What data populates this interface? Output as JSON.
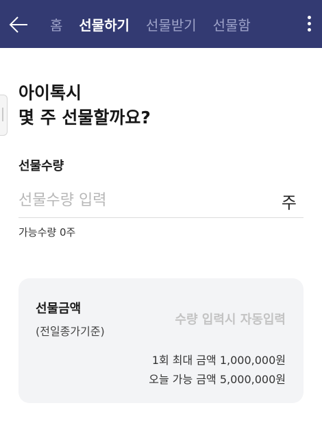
{
  "nav": {
    "tabs": [
      {
        "label": "홈",
        "active": false
      },
      {
        "label": "선물하기",
        "active": true
      },
      {
        "label": "선물받기",
        "active": false
      },
      {
        "label": "선물함",
        "active": false
      }
    ],
    "back_icon": "arrow-left-icon",
    "more_icon": "more-vertical-icon"
  },
  "main": {
    "question_line1": "아이톡시",
    "question_line2": "몇 주 선물할까요?",
    "quantity_label": "선물수량",
    "quantity_placeholder": "선물수량 입력",
    "quantity_value": "",
    "quantity_unit": "주",
    "available_text": "가능수량 0주"
  },
  "amount": {
    "title": "선물금액",
    "subtitle": "(전일종가기준)",
    "auto_text": "수량 입력시 자동입력",
    "limit_per_once": "1회 최대 금액 1,000,000원",
    "limit_today": "오늘 가능 금액 5,000,000원"
  },
  "colors": {
    "header_bg": "#333a72",
    "tab_active": "#ffffff",
    "tab_inactive": "#9ea3c9",
    "card_bg": "#f3f4f6"
  }
}
